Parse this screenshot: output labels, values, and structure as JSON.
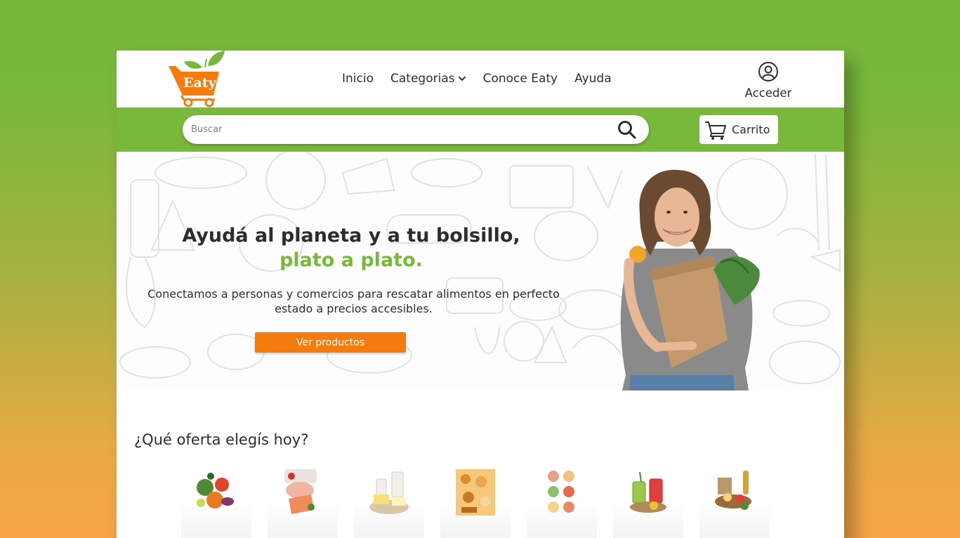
{
  "brand": {
    "logo_text": "Eaty",
    "accent_green": "#78b83a",
    "accent_orange": "#f47b0e"
  },
  "nav": {
    "items": [
      {
        "label": "Inicio"
      },
      {
        "label": "Categorias",
        "has_dropdown": true
      },
      {
        "label": "Conoce Eaty"
      },
      {
        "label": "Ayuda"
      }
    ]
  },
  "account": {
    "label": "Acceder",
    "icon": "user-circle-icon"
  },
  "search": {
    "placeholder": "Buscar",
    "value": "",
    "icon": "search-icon"
  },
  "cart": {
    "label": "Carrito",
    "icon": "cart-icon"
  },
  "hero": {
    "title_line1": "Ayudá al planeta y a tu bolsillo,",
    "title_line2": "plato a plato.",
    "subtitle": "Conectamos a personas y comercios para rescatar alimentos en perfecto estado a precios accesibles.",
    "cta": "Ver productos"
  },
  "offers": {
    "title": "¿Qué oferta elegís hoy?",
    "categories": [
      {
        "icon": "vegetables-icon"
      },
      {
        "icon": "meat-fish-icon"
      },
      {
        "icon": "dairy-icon"
      },
      {
        "icon": "bakery-icon"
      },
      {
        "icon": "prepared-meals-icon"
      },
      {
        "icon": "drinks-icon"
      },
      {
        "icon": "pantry-icon"
      }
    ]
  }
}
